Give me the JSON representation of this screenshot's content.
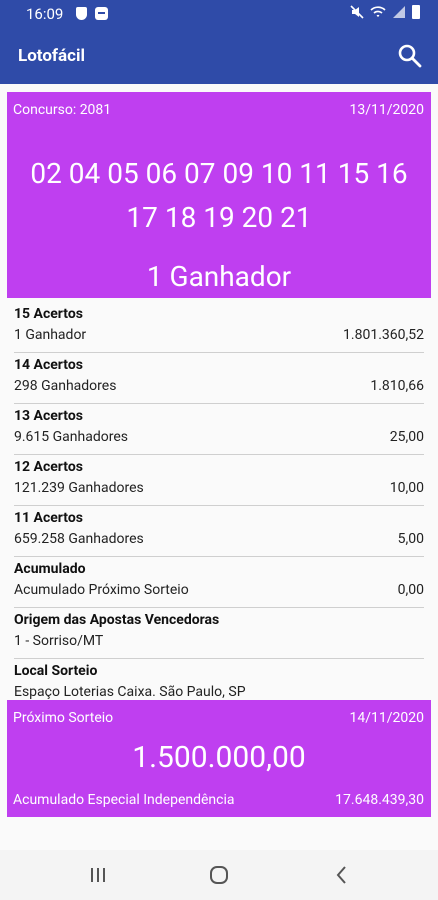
{
  "status_bar": {
    "time": "16:09"
  },
  "app": {
    "title": "Lotofácil"
  },
  "draw": {
    "concurso": "Concurso: 2081",
    "date": "13/11/2020",
    "numbers_line1": "02 04 05 06 07 09 10 11 15 16",
    "numbers_line2": "17 18 19 20 21",
    "winners": "1 Ganhador"
  },
  "prizes": [
    {
      "title": "15 Acertos",
      "left": "1 Ganhador",
      "right": "1.801.360,52"
    },
    {
      "title": "14 Acertos",
      "left": "298 Ganhadores",
      "right": "1.810,66"
    },
    {
      "title": "13 Acertos",
      "left": "9.615 Ganhadores",
      "right": "25,00"
    },
    {
      "title": "12 Acertos",
      "left": "121.239 Ganhadores",
      "right": "10,00"
    },
    {
      "title": "11 Acertos",
      "left": "659.258 Ganhadores",
      "right": "5,00"
    },
    {
      "title": "Acumulado",
      "left": "Acumulado Próximo Sorteio",
      "right": "0,00"
    },
    {
      "title": "Origem das Apostas Vencedoras",
      "left": "1 - Sorriso/MT",
      "right": ""
    },
    {
      "title": "Local Sorteio",
      "left": "Espaço Loterias Caixa. São Paulo, SP",
      "right": ""
    }
  ],
  "next": {
    "label": "Próximo Sorteio",
    "date": "14/11/2020",
    "amount": "1.500.000,00",
    "special_label": "Acumulado Especial Independência",
    "special_value": "17.648.439,30"
  },
  "colors": {
    "primary": "#2f4ba8",
    "accent": "#bf3ff0"
  }
}
